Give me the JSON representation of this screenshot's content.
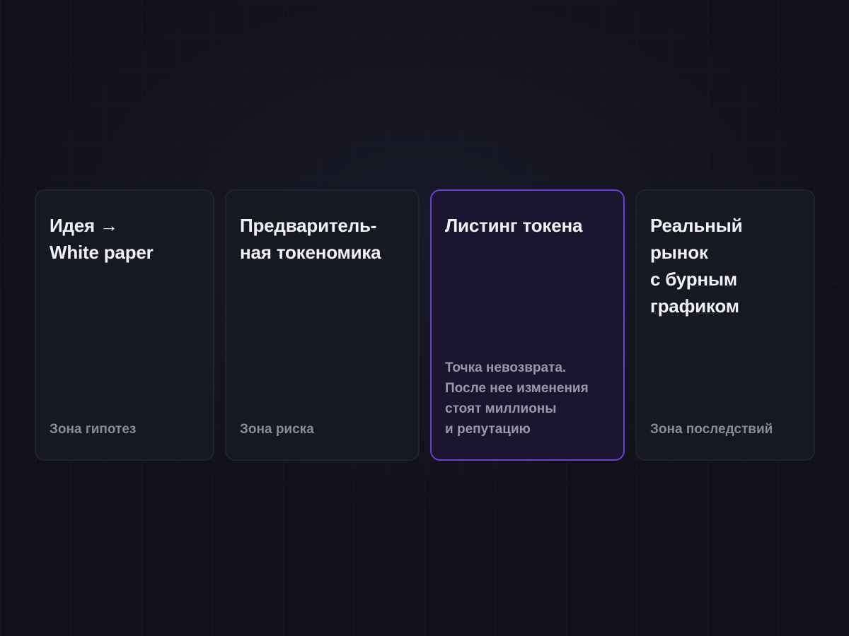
{
  "cards": [
    {
      "title": "Идея →\nWhite paper",
      "note": "Зона гипотез",
      "highlighted": false
    },
    {
      "title": "Предваритель-\nная токеномика",
      "note": "Зона риска",
      "highlighted": false
    },
    {
      "title": "Листинг токена",
      "note": "Точка невозврата.\nПосле нее изменения\nстоят миллионы\nи репутацию",
      "highlighted": true
    },
    {
      "title": "Реальный рынок\nс бурным\nграфиком",
      "note": "Зона последствий",
      "highlighted": false
    }
  ],
  "colors": {
    "background": "#111019",
    "card_background": "#161824",
    "card_border": "#1f2230",
    "highlight_background": "#1b1530",
    "highlight_border": "#6a3fd6",
    "title_text": "#f2f2f6",
    "note_text": "#8a8c97"
  }
}
